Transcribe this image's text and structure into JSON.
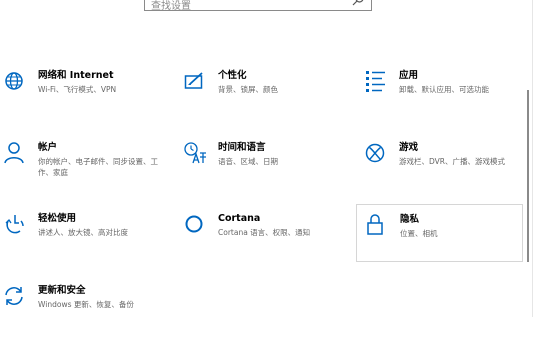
{
  "search": {
    "placeholder": "查找设置",
    "icon": "search-icon"
  },
  "accent": "#0067c0",
  "tiles": [
    {
      "title": "网络和 Internet",
      "desc": "Wi-Fi、飞行模式、VPN",
      "icon": "globe-icon"
    },
    {
      "title": "个性化",
      "desc": "背景、锁屏、颜色",
      "icon": "personalization-icon"
    },
    {
      "title": "应用",
      "desc": "卸载、默认应用、可选功能",
      "icon": "apps-icon"
    },
    {
      "title": "帐户",
      "desc": "你的帐户、电子邮件、同步设置、工作、家庭",
      "icon": "person-icon"
    },
    {
      "title": "时间和语言",
      "desc": "语音、区域、日期",
      "icon": "time-language-icon"
    },
    {
      "title": "游戏",
      "desc": "游戏栏、DVR、广播、游戏模式",
      "icon": "xbox-icon"
    },
    {
      "title": "轻松使用",
      "desc": "讲述人、放大镜、高对比度",
      "icon": "ease-of-access-icon"
    },
    {
      "title": "Cortana",
      "desc": "Cortana 语言、权限、通知",
      "icon": "cortana-icon"
    },
    {
      "title": "隐私",
      "desc": "位置、相机",
      "icon": "lock-icon"
    },
    {
      "title": "更新和安全",
      "desc": "Windows 更新、恢复、备份",
      "icon": "update-icon"
    }
  ]
}
